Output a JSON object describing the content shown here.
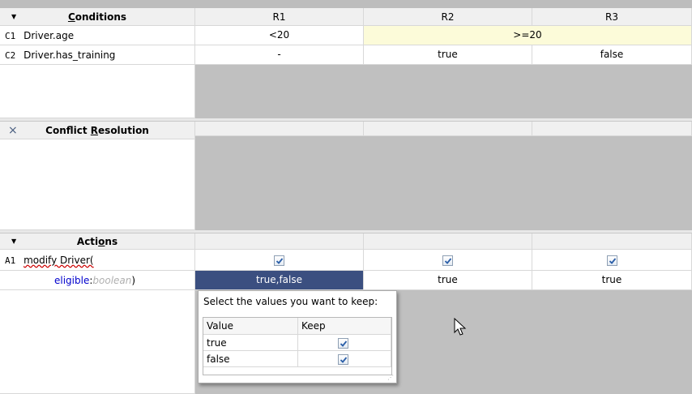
{
  "columns": [
    "R1",
    "R2",
    "R3"
  ],
  "conditions": {
    "title": "Conditions",
    "title_underline": "C",
    "title_rest": "onditions",
    "rows": [
      {
        "id": "C1",
        "expr": "Driver.age",
        "values": [
          "<20",
          ">=20"
        ]
      },
      {
        "id": "C2",
        "expr": "Driver.has_training",
        "values": [
          "-",
          "true",
          "false"
        ]
      }
    ]
  },
  "conflict": {
    "title_pre": "Conflict ",
    "title_underline": "R",
    "title_rest": "esolution",
    "close_icon": "×"
  },
  "actions": {
    "title_pre": "Acti",
    "title_underline": "o",
    "title_rest": "ns",
    "rows": [
      {
        "id": "A1",
        "expr": "modify Driver(",
        "checked": [
          true,
          true,
          true
        ]
      },
      {
        "field": "eligible",
        "sep": ":",
        "type": "boolean",
        "close": ")",
        "values": [
          "true,false",
          "true",
          "true"
        ]
      }
    ]
  },
  "popup": {
    "prompt": "Select the values you want to keep:",
    "headers": [
      "Value",
      "Keep"
    ],
    "rows": [
      {
        "value": "true",
        "keep": true
      },
      {
        "value": "false",
        "keep": true
      }
    ]
  },
  "colors": {
    "selected_cell": "#3b4f80",
    "highlight_cell": "#fcfbd9",
    "field_blue": "#0000cc"
  }
}
